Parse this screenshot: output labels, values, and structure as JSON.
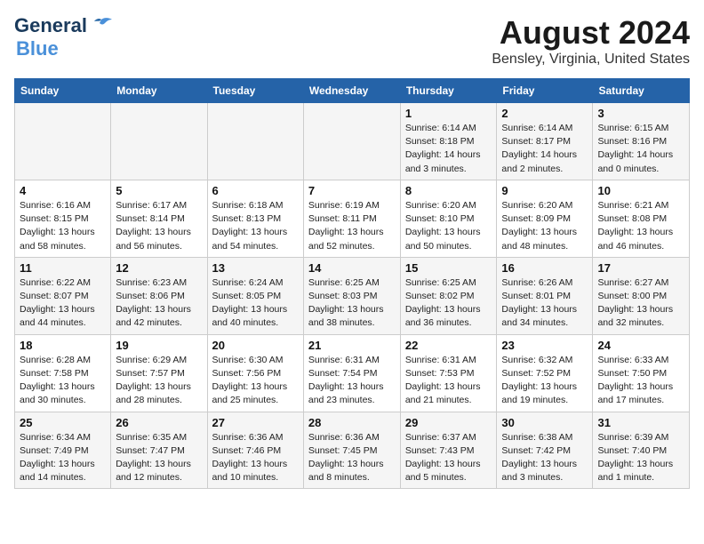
{
  "header": {
    "logo_line1": "General",
    "logo_line2": "Blue",
    "title": "August 2024",
    "subtitle": "Bensley, Virginia, United States"
  },
  "calendar": {
    "days_of_week": [
      "Sunday",
      "Monday",
      "Tuesday",
      "Wednesday",
      "Thursday",
      "Friday",
      "Saturday"
    ],
    "weeks": [
      [
        {
          "day": "",
          "info": ""
        },
        {
          "day": "",
          "info": ""
        },
        {
          "day": "",
          "info": ""
        },
        {
          "day": "",
          "info": ""
        },
        {
          "day": "1",
          "info": "Sunrise: 6:14 AM\nSunset: 8:18 PM\nDaylight: 14 hours\nand 3 minutes."
        },
        {
          "day": "2",
          "info": "Sunrise: 6:14 AM\nSunset: 8:17 PM\nDaylight: 14 hours\nand 2 minutes."
        },
        {
          "day": "3",
          "info": "Sunrise: 6:15 AM\nSunset: 8:16 PM\nDaylight: 14 hours\nand 0 minutes."
        }
      ],
      [
        {
          "day": "4",
          "info": "Sunrise: 6:16 AM\nSunset: 8:15 PM\nDaylight: 13 hours\nand 58 minutes."
        },
        {
          "day": "5",
          "info": "Sunrise: 6:17 AM\nSunset: 8:14 PM\nDaylight: 13 hours\nand 56 minutes."
        },
        {
          "day": "6",
          "info": "Sunrise: 6:18 AM\nSunset: 8:13 PM\nDaylight: 13 hours\nand 54 minutes."
        },
        {
          "day": "7",
          "info": "Sunrise: 6:19 AM\nSunset: 8:11 PM\nDaylight: 13 hours\nand 52 minutes."
        },
        {
          "day": "8",
          "info": "Sunrise: 6:20 AM\nSunset: 8:10 PM\nDaylight: 13 hours\nand 50 minutes."
        },
        {
          "day": "9",
          "info": "Sunrise: 6:20 AM\nSunset: 8:09 PM\nDaylight: 13 hours\nand 48 minutes."
        },
        {
          "day": "10",
          "info": "Sunrise: 6:21 AM\nSunset: 8:08 PM\nDaylight: 13 hours\nand 46 minutes."
        }
      ],
      [
        {
          "day": "11",
          "info": "Sunrise: 6:22 AM\nSunset: 8:07 PM\nDaylight: 13 hours\nand 44 minutes."
        },
        {
          "day": "12",
          "info": "Sunrise: 6:23 AM\nSunset: 8:06 PM\nDaylight: 13 hours\nand 42 minutes."
        },
        {
          "day": "13",
          "info": "Sunrise: 6:24 AM\nSunset: 8:05 PM\nDaylight: 13 hours\nand 40 minutes."
        },
        {
          "day": "14",
          "info": "Sunrise: 6:25 AM\nSunset: 8:03 PM\nDaylight: 13 hours\nand 38 minutes."
        },
        {
          "day": "15",
          "info": "Sunrise: 6:25 AM\nSunset: 8:02 PM\nDaylight: 13 hours\nand 36 minutes."
        },
        {
          "day": "16",
          "info": "Sunrise: 6:26 AM\nSunset: 8:01 PM\nDaylight: 13 hours\nand 34 minutes."
        },
        {
          "day": "17",
          "info": "Sunrise: 6:27 AM\nSunset: 8:00 PM\nDaylight: 13 hours\nand 32 minutes."
        }
      ],
      [
        {
          "day": "18",
          "info": "Sunrise: 6:28 AM\nSunset: 7:58 PM\nDaylight: 13 hours\nand 30 minutes."
        },
        {
          "day": "19",
          "info": "Sunrise: 6:29 AM\nSunset: 7:57 PM\nDaylight: 13 hours\nand 28 minutes."
        },
        {
          "day": "20",
          "info": "Sunrise: 6:30 AM\nSunset: 7:56 PM\nDaylight: 13 hours\nand 25 minutes."
        },
        {
          "day": "21",
          "info": "Sunrise: 6:31 AM\nSunset: 7:54 PM\nDaylight: 13 hours\nand 23 minutes."
        },
        {
          "day": "22",
          "info": "Sunrise: 6:31 AM\nSunset: 7:53 PM\nDaylight: 13 hours\nand 21 minutes."
        },
        {
          "day": "23",
          "info": "Sunrise: 6:32 AM\nSunset: 7:52 PM\nDaylight: 13 hours\nand 19 minutes."
        },
        {
          "day": "24",
          "info": "Sunrise: 6:33 AM\nSunset: 7:50 PM\nDaylight: 13 hours\nand 17 minutes."
        }
      ],
      [
        {
          "day": "25",
          "info": "Sunrise: 6:34 AM\nSunset: 7:49 PM\nDaylight: 13 hours\nand 14 minutes."
        },
        {
          "day": "26",
          "info": "Sunrise: 6:35 AM\nSunset: 7:47 PM\nDaylight: 13 hours\nand 12 minutes."
        },
        {
          "day": "27",
          "info": "Sunrise: 6:36 AM\nSunset: 7:46 PM\nDaylight: 13 hours\nand 10 minutes."
        },
        {
          "day": "28",
          "info": "Sunrise: 6:36 AM\nSunset: 7:45 PM\nDaylight: 13 hours\nand 8 minutes."
        },
        {
          "day": "29",
          "info": "Sunrise: 6:37 AM\nSunset: 7:43 PM\nDaylight: 13 hours\nand 5 minutes."
        },
        {
          "day": "30",
          "info": "Sunrise: 6:38 AM\nSunset: 7:42 PM\nDaylight: 13 hours\nand 3 minutes."
        },
        {
          "day": "31",
          "info": "Sunrise: 6:39 AM\nSunset: 7:40 PM\nDaylight: 13 hours\nand 1 minute."
        }
      ]
    ]
  }
}
